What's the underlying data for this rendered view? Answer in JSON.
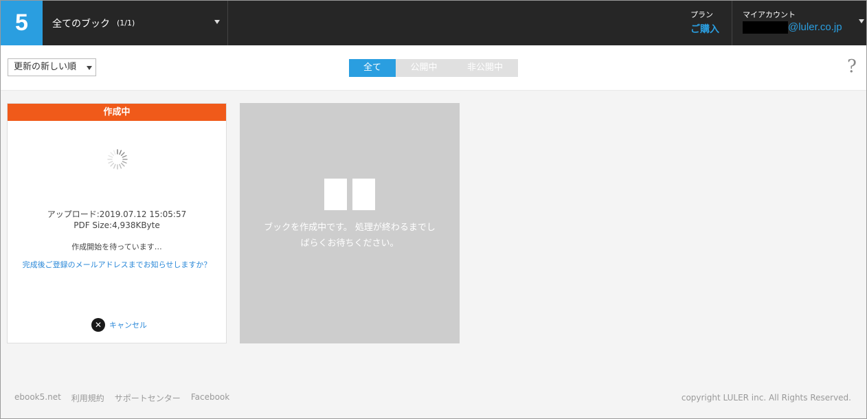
{
  "header": {
    "logo": "5",
    "book_select": {
      "name": "全てのブック",
      "count": "(1/1)"
    },
    "plan": {
      "label": "プラン",
      "buy": "ご購入"
    },
    "account": {
      "label": "マイアカウント",
      "email_suffix": "@luler.co.jp"
    }
  },
  "toolbar": {
    "sort_label": "更新の新しい順",
    "filters": [
      {
        "label": "全て",
        "active": true
      },
      {
        "label": "公開中",
        "active": false
      },
      {
        "label": "非公開中",
        "active": false
      }
    ],
    "help": "?"
  },
  "card": {
    "status": "作成中",
    "upload": "アップロード:2019.07.12 15:05:57",
    "size": "PDF Size:4,938KByte",
    "waiting": "作成開始を待っています…",
    "notify": "完成後ご登録のメールアドレスまでお知らせしますか？",
    "cancel": "キャンセル"
  },
  "placeholder": {
    "line1": "ブックを作成中です。 処理が終わるまでし",
    "line2": "ばらくお待ちください。"
  },
  "footer": {
    "links": [
      "ebook5.net",
      "利用規約",
      "サポートセンター",
      "Facebook"
    ],
    "copyright": "copyright LULER inc. All Rights Reserved."
  },
  "colors": {
    "brand_blue": "#2a9ee0",
    "status_orange": "#f05a1a",
    "header_bg": "#262626"
  }
}
